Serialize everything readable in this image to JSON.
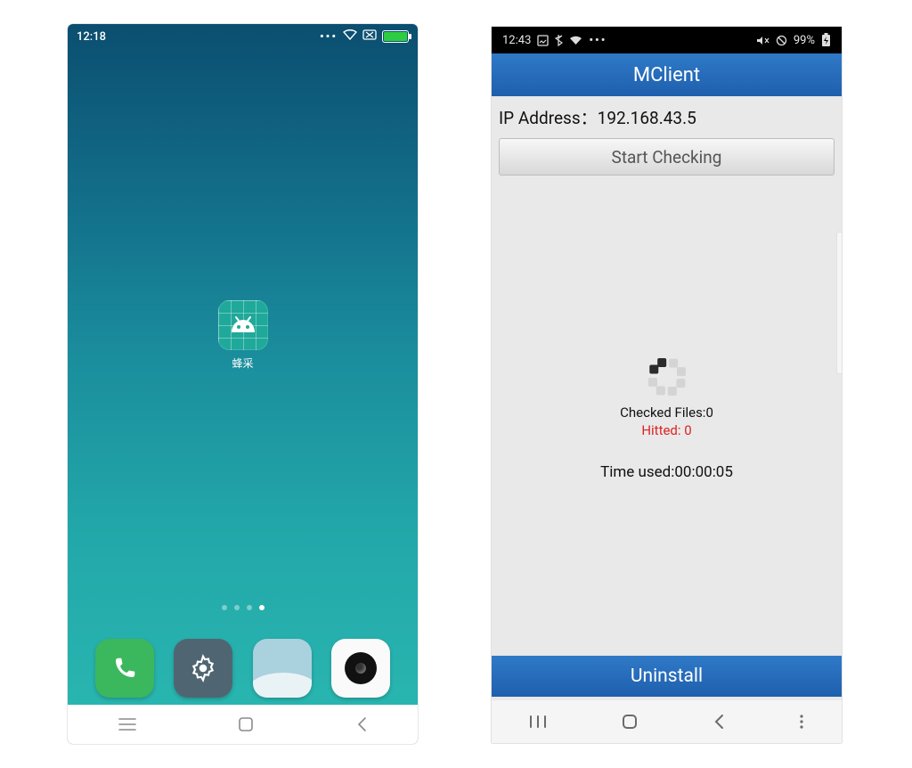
{
  "left": {
    "statusbar": {
      "time": "12:18"
    },
    "app": {
      "label": "蜂采"
    },
    "dock": {
      "items": [
        "phone",
        "settings",
        "gallery",
        "camera"
      ]
    }
  },
  "right": {
    "statusbar": {
      "time": "12:43",
      "battery_text": "99%"
    },
    "title": "MClient",
    "ip_label": "IP Address：192.168.43.5",
    "start_label": "Start Checking",
    "checked_label": "Checked Files:0",
    "hitted_label": "Hitted: 0",
    "time_used_label": "Time used:00:00:05",
    "uninstall_label": "Uninstall"
  }
}
